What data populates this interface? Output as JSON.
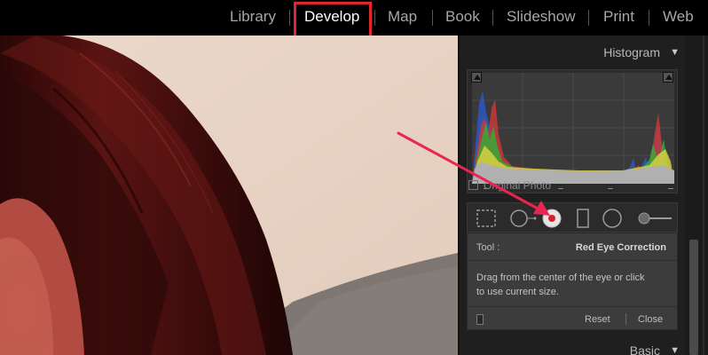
{
  "modules": [
    {
      "label": "Library",
      "active": false
    },
    {
      "label": "Develop",
      "active": true
    },
    {
      "label": "Map",
      "active": false
    },
    {
      "label": "Book",
      "active": false
    },
    {
      "label": "Slideshow",
      "active": false
    },
    {
      "label": "Print",
      "active": false
    },
    {
      "label": "Web",
      "active": false
    }
  ],
  "histogram": {
    "title": "Histogram",
    "original_photo_label": "Original Photo"
  },
  "tool_panel": {
    "tool_label": "Tool :",
    "tool_name": "Red Eye Correction",
    "description": "Drag from the center of the eye or click to use current size.",
    "reset_label": "Reset",
    "close_label": "Close"
  },
  "basic": {
    "title": "Basic"
  },
  "tools": [
    "crop-overlay-icon",
    "spot-removal-icon",
    "red-eye-correction-icon",
    "graduated-filter-icon",
    "radial-filter-icon",
    "adjustment-brush-icon"
  ],
  "colors": {
    "highlight": "#e0262f",
    "arrow": "#e8264f",
    "active_module": "#ffffff",
    "inactive_module": "#a7a7a7",
    "panel_bg": "#1f1f1f"
  }
}
